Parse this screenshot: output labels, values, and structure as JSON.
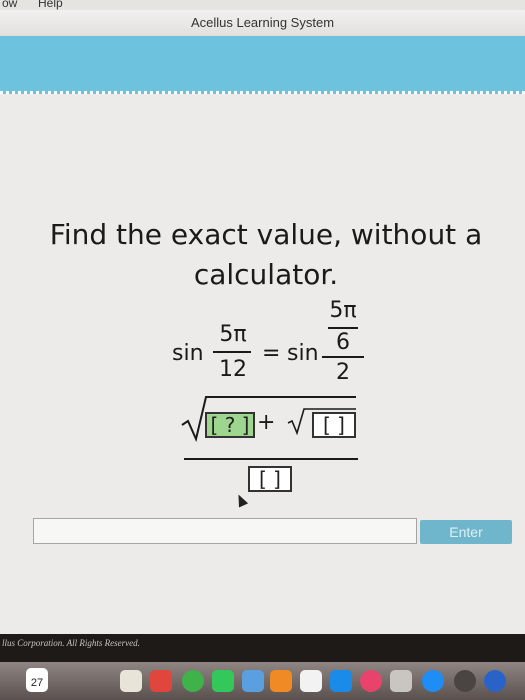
{
  "menubar": {
    "items": [
      "ow",
      "Help"
    ]
  },
  "window": {
    "title": "Acellus Learning System"
  },
  "question": {
    "prompt": "Find the exact value, without a calculator.",
    "lhs": {
      "func": "sin",
      "num": "5π",
      "den": "12"
    },
    "equals": "=",
    "rhs": {
      "func": "sin",
      "num": "5π",
      "num_den": "6",
      "den": "2"
    },
    "answer": {
      "box1": "[ ? ]",
      "plus": "+",
      "box2": "[   ]",
      "den_box": "[   ]"
    }
  },
  "answer_bar": {
    "input_value": "",
    "enter_label": "Enter"
  },
  "footer": {
    "copyright": "llus Corporation.  All Rights Reserved."
  },
  "dock": {
    "calendar_day": "27"
  }
}
